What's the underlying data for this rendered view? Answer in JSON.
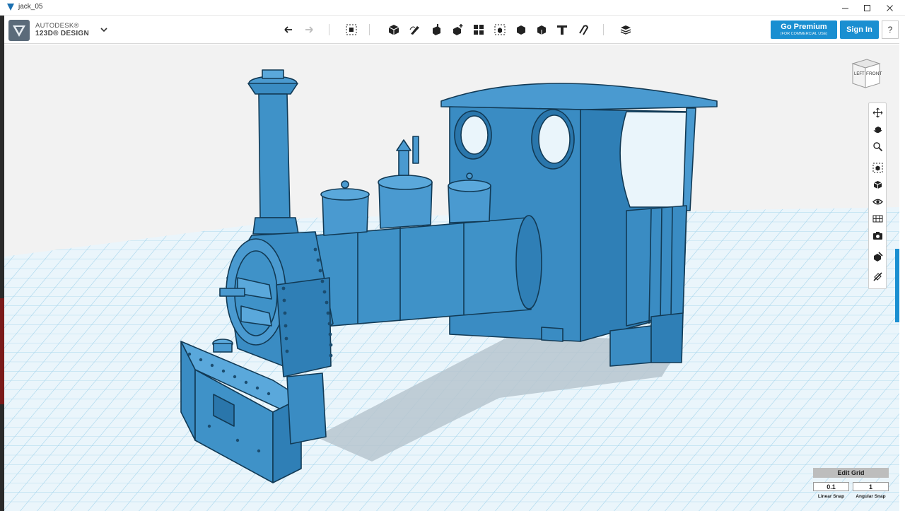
{
  "window": {
    "title": "jack_05",
    "controls": [
      "minimize-icon",
      "maximize-icon",
      "close-icon"
    ]
  },
  "app": {
    "brand_line1": "AUTODESK®",
    "brand_line2": "123D® DESIGN",
    "menu_icon": "chevron-down-icon"
  },
  "toolbar": {
    "groups": [
      [
        "undo-icon",
        "redo-icon"
      ],
      [
        "transform-icon"
      ],
      [
        "primitives-icon",
        "sketch-icon",
        "construct-icon",
        "modify-icon",
        "pattern-icon",
        "grouping-icon",
        "combine-icon",
        "measure-icon",
        "text-icon",
        "snap-icon"
      ],
      [
        "materials-icon"
      ]
    ],
    "premium_label": "Go Premium",
    "premium_sublabel": "(FOR COMMERCIAL USE)",
    "signin_label": "Sign In",
    "help_label": "?"
  },
  "viewcube": {
    "left_face": "LEFT",
    "front_face": "FRONT"
  },
  "navbar": {
    "tools": [
      "pan-icon",
      "orbit-icon",
      "zoom-icon",
      "fit-icon",
      "view-icon",
      "visibility-icon",
      "materials-view-icon",
      "screenshot-icon",
      "snap-to-icon",
      "measure-view-icon"
    ]
  },
  "grid": {
    "edit_label": "Edit Grid",
    "linear_snap_value": "0.1",
    "angular_snap_value": "1",
    "linear_snap_label": "Linear Snap",
    "angular_snap_label": "Angular Snap"
  },
  "colors": {
    "accent": "#1a8fd1",
    "model": "#3f92c8",
    "grid_line": "#8fcbe8",
    "viewport_bg": "#f2f2f2"
  }
}
